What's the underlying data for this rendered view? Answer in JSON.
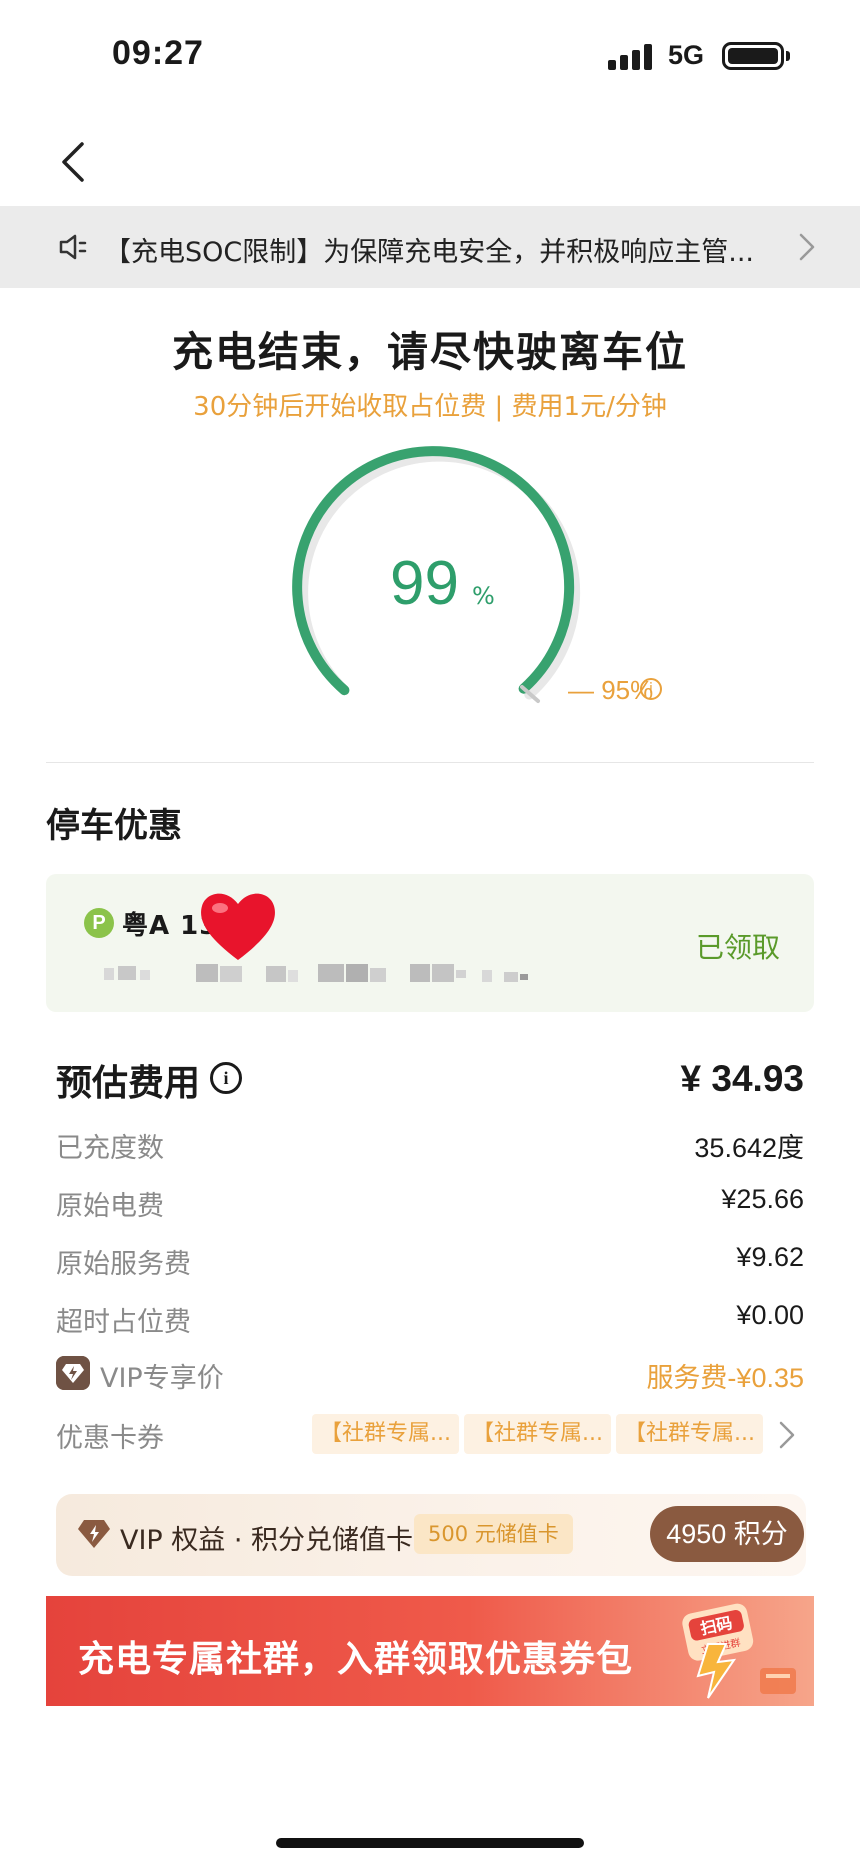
{
  "status_bar": {
    "time": "09:27",
    "network": "5G"
  },
  "notice": {
    "text": "【充电SOC限制】为保障充电安全，并积极响应主管..."
  },
  "header": {
    "title": "充电结束，请尽快驶离车位",
    "subtitle": "30分钟后开始收取占位费 | 费用1元/分钟"
  },
  "gauge": {
    "percent": "99",
    "percent_sign": "%",
    "limit_label": "95%",
    "limit_marker": "— 95%"
  },
  "parking": {
    "title": "停车优惠",
    "badge": "P",
    "plate": "粤A    13",
    "status": "已领取"
  },
  "fees": {
    "title": "预估费用",
    "total": "¥ 34.93",
    "rows": [
      {
        "label": "已充度数",
        "value": "35.642度"
      },
      {
        "label": "原始电费",
        "value": "¥25.66"
      },
      {
        "label": "原始服务费",
        "value": "¥9.62"
      },
      {
        "label": "超时占位费",
        "value": "¥0.00"
      }
    ],
    "vip": {
      "label": "VIP专享价",
      "value": "服务费-¥0.35"
    },
    "coupons": {
      "label": "优惠卡券",
      "chips": [
        "【社群专属...",
        "【社群专属...",
        "【社群专属..."
      ]
    }
  },
  "vip_banner": {
    "text": "VIP 权益 · 积分兑储值卡",
    "chip": "500 元储值卡",
    "points": "4950 积分"
  },
  "promo_banner": {
    "text": "充电专属社群，入群领取优惠券包",
    "badge": "扫码",
    "badge_sub": "立即进群"
  },
  "colors": {
    "green": "#2e9e6b",
    "orange": "#e9a13c",
    "notice_bg": "#ebebeb",
    "red": "#e5433c"
  }
}
